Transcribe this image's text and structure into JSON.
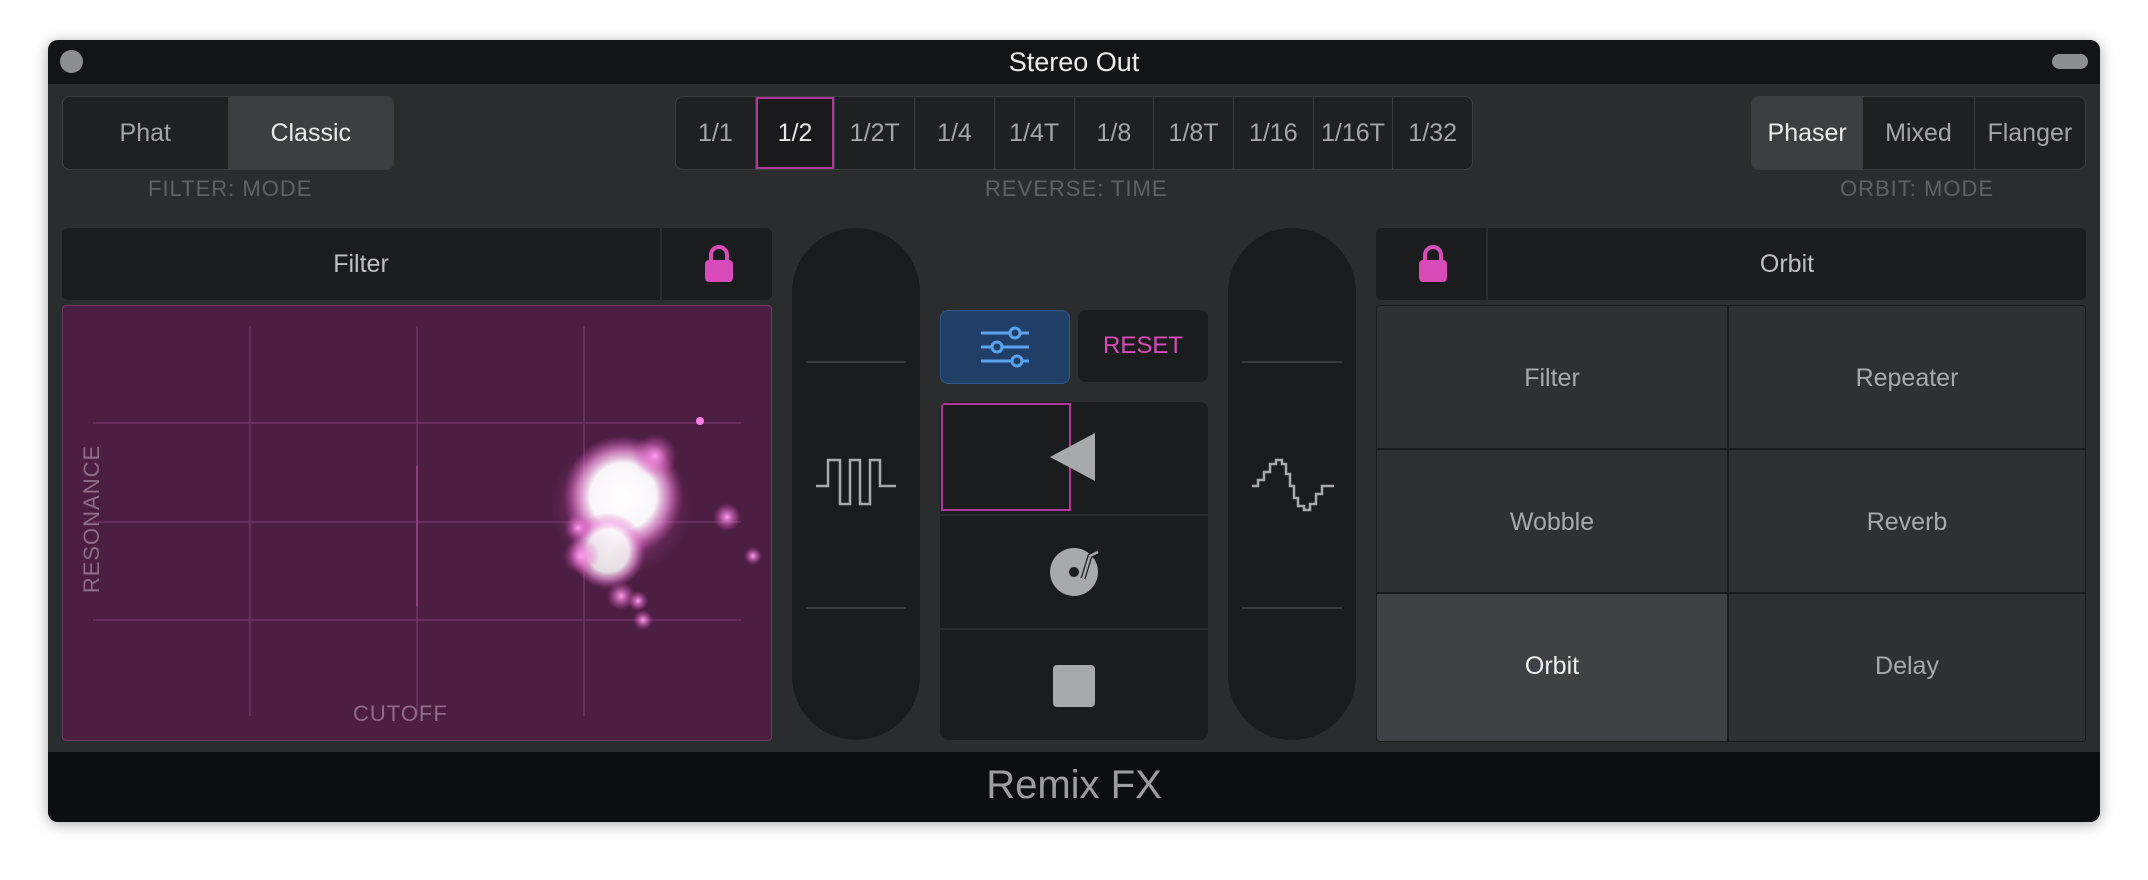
{
  "window": {
    "title": "Stereo Out"
  },
  "filter_mode": {
    "options": [
      "Phat",
      "Classic"
    ],
    "selected": "Classic",
    "caption": "FILTER: MODE"
  },
  "reverse_time": {
    "options": [
      "1/1",
      "1/2",
      "1/2T",
      "1/4",
      "1/4T",
      "1/8",
      "1/8T",
      "1/16",
      "1/16T",
      "1/32"
    ],
    "selected": "1/2",
    "caption": "REVERSE: TIME"
  },
  "orbit_mode": {
    "options": [
      "Phaser",
      "Mixed",
      "Flanger"
    ],
    "selected": "Phaser",
    "caption": "ORBIT: MODE"
  },
  "filter_panel": {
    "title": "Filter",
    "x_label": "CUTOFF",
    "y_label": "RESONANCE"
  },
  "center": {
    "reset_label": "RESET"
  },
  "orbit_panel": {
    "title": "Orbit",
    "effects": [
      "Filter",
      "Repeater",
      "Wobble",
      "Reverb",
      "Orbit",
      "Delay"
    ],
    "selected": "Orbit"
  },
  "footer": {
    "title": "Remix FX"
  },
  "colors": {
    "accent": "#d84bb9",
    "settings_button": "#213e66",
    "pad_background": "#4c1f42"
  },
  "icons": {
    "lock": "lock-icon",
    "settings": "sliders-icon",
    "reverse": "play-reverse-icon",
    "scratch": "vinyl-scratch-icon",
    "stop": "stop-icon",
    "gate": "gate-square-wave-icon",
    "downsampler": "stepped-sine-wave-icon"
  }
}
